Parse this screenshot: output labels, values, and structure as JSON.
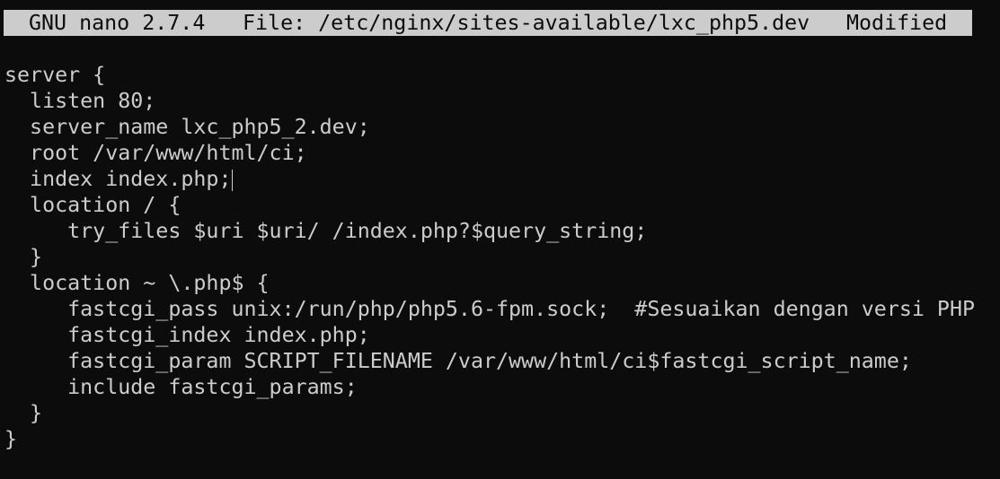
{
  "header": {
    "app": "GNU nano 2.7.4",
    "file": "File: /etc/nginx/sites-available/lxc_php5.dev",
    "status": "Modified"
  },
  "editor": {
    "lines": [
      "",
      "server {",
      "  listen 80;",
      "  server_name lxc_php5_2.dev;",
      "  root /var/www/html/ci;",
      "  index index.php;",
      "  location / {",
      "     try_files $uri $uri/ /index.php?$query_string;",
      "  }",
      "  location ~ \\.php$ {",
      "     fastcgi_pass unix:/run/php/php5.6-fpm.sock;  #Sesuaikan dengan versi PHP",
      "     fastcgi_index index.php;",
      "     fastcgi_param SCRIPT_FILENAME /var/www/html/ci$fastcgi_script_name;",
      "     include fastcgi_params;",
      "  }",
      "}"
    ]
  }
}
